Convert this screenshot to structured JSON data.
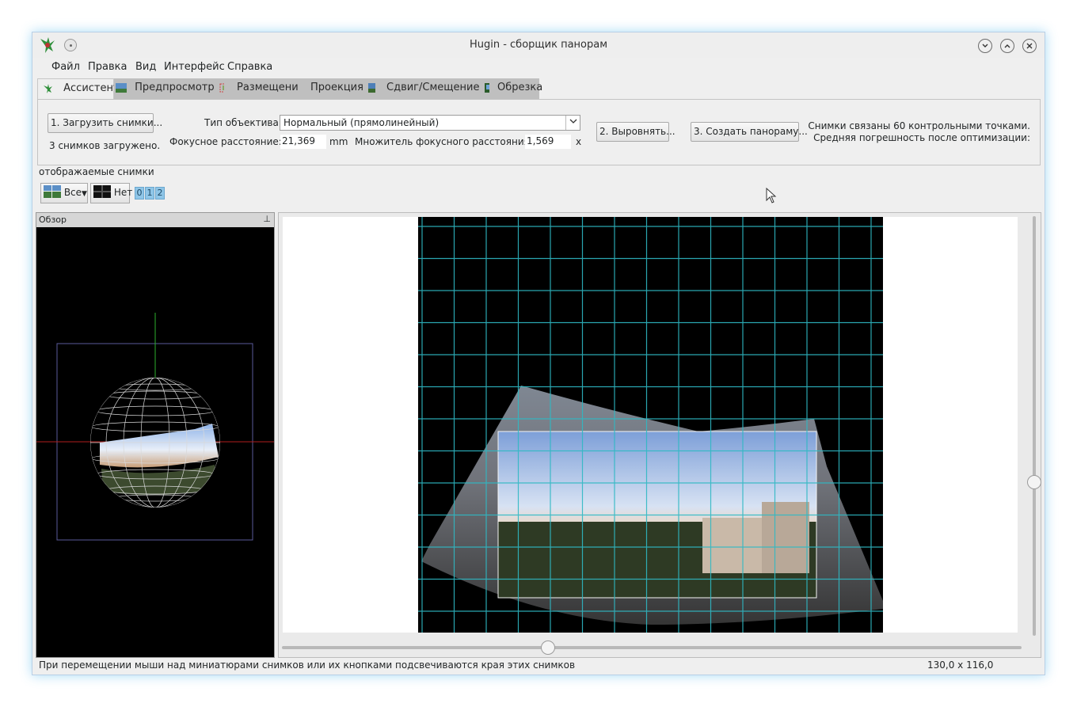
{
  "window": {
    "title": "Hugin - сборщик панорам"
  },
  "menu": [
    "Файл",
    "Правка",
    "Вид",
    "Интерфейс",
    "Справка"
  ],
  "tabs": [
    {
      "label": "Ассистент",
      "icon": "assistant-icon"
    },
    {
      "label": "Предпросмотр",
      "icon": "gl-preview-icon"
    },
    {
      "label": "Размещение",
      "icon": "layout-icon"
    },
    {
      "label": "Проекция",
      "icon": "projection-icon"
    },
    {
      "label": "Сдвиг/Смещение",
      "icon": "move-drag-icon"
    },
    {
      "label": "Обрезка",
      "icon": ""
    }
  ],
  "assistant": {
    "load_button": "1. Загрузить снимки...",
    "loaded_status": "3 снимков загружено.",
    "lens_type_label": "Тип объектива:",
    "lens_type_value": "Нормальный (прямолинейный)",
    "focal_length_label": "Фокусное расстояние:",
    "focal_length_value": "21,369",
    "focal_length_unit": "mm",
    "crop_factor_label": "Множитель фокусного расстояния:",
    "crop_factor_value": "1,569",
    "crop_factor_unit": "x",
    "align_button": "2. Выровнять...",
    "create_button": "3. Создать панораму...",
    "info_line1": "Снимки связаны 60 контрольными точками.",
    "info_line2": "Средняя погрешность после оптимизации:"
  },
  "displayed_images": {
    "label": "отображаемые снимки",
    "all_button": "Все",
    "none_button": "Нет",
    "image_numbers": [
      "0",
      "1",
      "2"
    ]
  },
  "overview": {
    "title": "Обзор"
  },
  "statusbar": {
    "hint": "При перемещении мыши над миниатюрами снимков или их кнопками подсвечиваются края этих снимков",
    "size": "130,0 x 116,0"
  },
  "colors": {
    "grid": "#2fb9c4",
    "accent": "#3daee9",
    "tab_inactive": "#bfbfbf"
  }
}
